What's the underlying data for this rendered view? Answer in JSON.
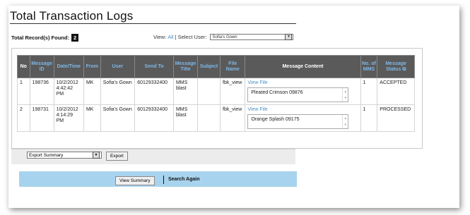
{
  "page": {
    "title": "Total Transaction Logs"
  },
  "records": {
    "label": "Total Record(s) Found:",
    "count": "2"
  },
  "filter": {
    "view_label": "View:",
    "view_all": "All",
    "select_user_label": "| Select User:",
    "selected_user": "Sofia's Gown"
  },
  "table": {
    "headers": {
      "no": "No",
      "message_id": "Message ID",
      "datetime": "Date/Time",
      "from": "From",
      "user": "User",
      "send_to": "Send To",
      "message_title": "Message Title",
      "subject": "Subject",
      "file_name": "File Name",
      "message_content": "Message Content",
      "no_of_mms": "No. of MMS",
      "message_status": "Message Status"
    },
    "rows": [
      {
        "no": "1",
        "message_id": "198736",
        "datetime": "10/2/2012 4:42:42 PM",
        "from": "MK",
        "user": "Sofia's Gown",
        "send_to": "60129332400",
        "message_title": "MMS blast",
        "subject": "",
        "file_name": "fbk_view",
        "view_file": "View File",
        "content": "Pleated Crimson 09876",
        "mms": "1",
        "status": "ACCEPTED"
      },
      {
        "no": "2",
        "message_id": "198731",
        "datetime": "10/2/2012 4:14:29 PM",
        "from": "MK",
        "user": "Sofia's Gown",
        "send_to": "60129332400",
        "message_title": "MMS blast",
        "subject": "",
        "file_name": "fbk_view",
        "view_file": "View File",
        "content": "Orange Splash 09175",
        "mms": "1",
        "status": "PROCESSED"
      }
    ]
  },
  "export": {
    "selected": "Export Summary",
    "button": "Export"
  },
  "bottom": {
    "view_summary": "View Summary",
    "search_again": "Search Again"
  },
  "colors": {
    "header_bg": "#5a5a5a",
    "header_link": "#7fb7e6",
    "link": "#4a90c8",
    "bottom_bar": "#a8d3ee"
  }
}
